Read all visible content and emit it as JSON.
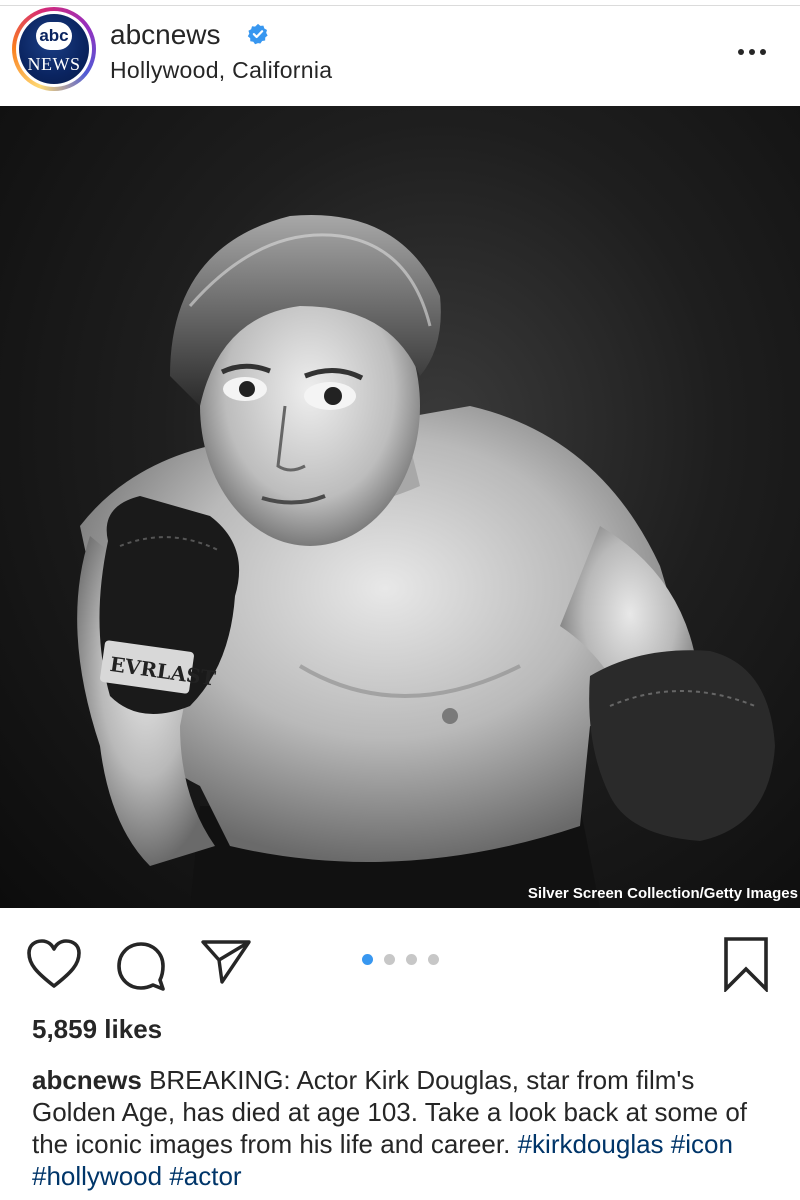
{
  "post": {
    "username": "abcnews",
    "location": "Hollywood, California",
    "verified": true,
    "avatar": {
      "top_text": "abc",
      "bottom_text": "NEWS"
    },
    "photo_credit": "Silver Screen Collection/Getty Images",
    "carousel": {
      "total": 4,
      "active_index": 0
    },
    "likes": "5,859 likes",
    "caption": {
      "username": "abcnews",
      "text": "BREAKING: Actor Kirk Douglas, star from film's Golden Age, has died at age 103. Take a look back at some of the iconic images from his life and career.",
      "hashtags": [
        "#kirkdouglas",
        "#icon",
        "#hollywood",
        "#actor"
      ]
    }
  },
  "icons": {
    "verified": "verified-badge-icon",
    "more": "more-options-icon",
    "like": "heart-icon",
    "comment": "comment-icon",
    "share": "paper-plane-icon",
    "save": "bookmark-icon"
  },
  "colors": {
    "text": "#262626",
    "verified_blue": "#3897f0",
    "hashtag": "#003569",
    "active_dot": "#3897f0",
    "inactive_dot": "#c7c7c7",
    "avatar_navy": "#0a2460"
  }
}
